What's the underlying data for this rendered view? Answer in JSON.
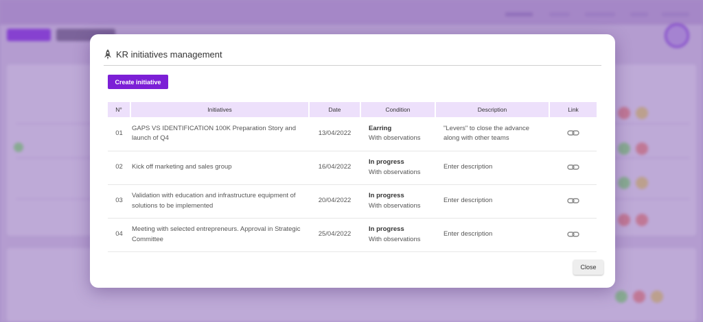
{
  "modal": {
    "title": "KR initiatives management",
    "create_button": "Create initiative",
    "close_button": "Close",
    "table": {
      "headers": [
        "N°",
        "Initiatives",
        "Date",
        "Condition",
        "Description",
        "Link"
      ],
      "rows": [
        {
          "num": "01",
          "initiative": "GAPS VS IDENTIFICATION 100K Preparation Story and launch of Q4",
          "date": "13/04/2022",
          "condition": "Earring",
          "condition_note": "With observations",
          "description": "\"Levers\" to close the advance along with other teams"
        },
        {
          "num": "02",
          "initiative": "Kick off marketing and sales group",
          "date": "16/04/2022",
          "condition": "In progress",
          "condition_note": "With observations",
          "description": "Enter description"
        },
        {
          "num": "03",
          "initiative": "Validation with education and infrastructure equipment of solutions to be implemented",
          "date": "20/04/2022",
          "condition": "In progress",
          "condition_note": "With observations",
          "description": "Enter description"
        },
        {
          "num": "04",
          "initiative": "Meeting with selected entrepreneurs. Approval in Strategic Committee",
          "date": "25/04/2022",
          "condition": "In progress",
          "condition_note": "With observations",
          "description": "Enter description"
        }
      ]
    }
  },
  "colors": {
    "accent": "#7c1fd6",
    "header_bg": "#ede0fb"
  },
  "icons": {
    "title": "rocket-icon",
    "link": "link-chain-icon"
  }
}
